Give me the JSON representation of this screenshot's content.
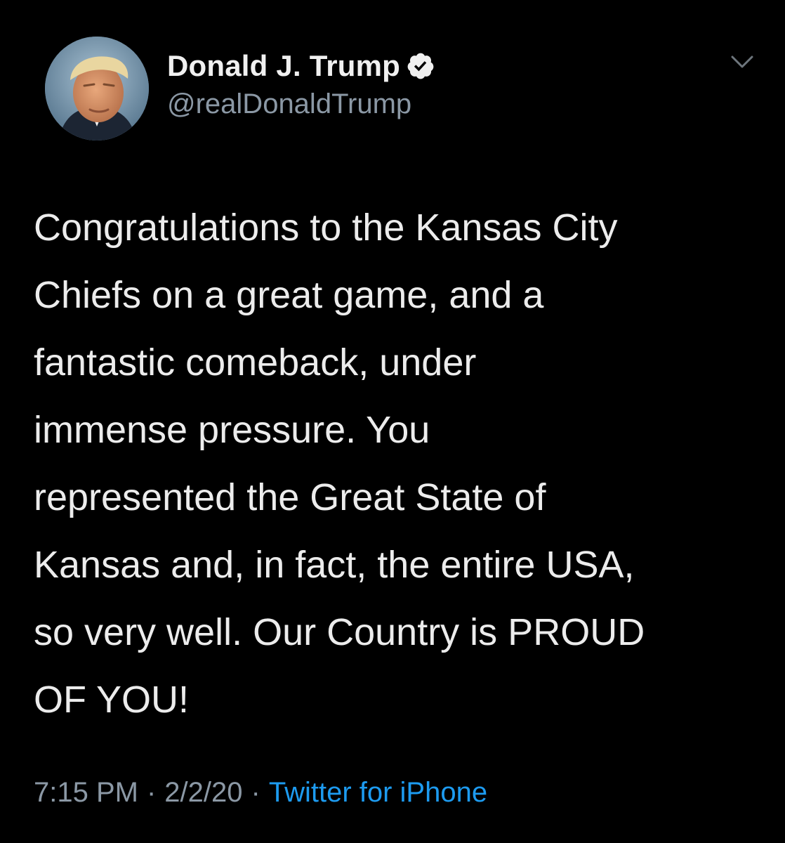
{
  "user": {
    "display_name": "Donald J. Trump",
    "handle": "@realDonaldTrump",
    "verified": true,
    "avatar_icon": "profile-photo"
  },
  "tweet": {
    "text_lines": [
      "Congratulations to the Kansas City",
      "Chiefs on a great game, and a",
      "fantastic comeback, under",
      "immense pressure. You",
      "represented the Great State of",
      "Kansas and, in fact, the entire USA,",
      "so very well. Our Country is PROUD",
      "OF YOU!"
    ],
    "time": "7:15 PM",
    "date": "2/2/20",
    "separator": "·",
    "source": "Twitter for iPhone"
  },
  "icons": {
    "verified_badge": "verified-check-icon",
    "menu": "chevron-down-icon"
  },
  "colors": {
    "background": "#000000",
    "text": "#e7e9ea",
    "secondary_text": "#8b98a5",
    "link": "#1d9bf0"
  }
}
